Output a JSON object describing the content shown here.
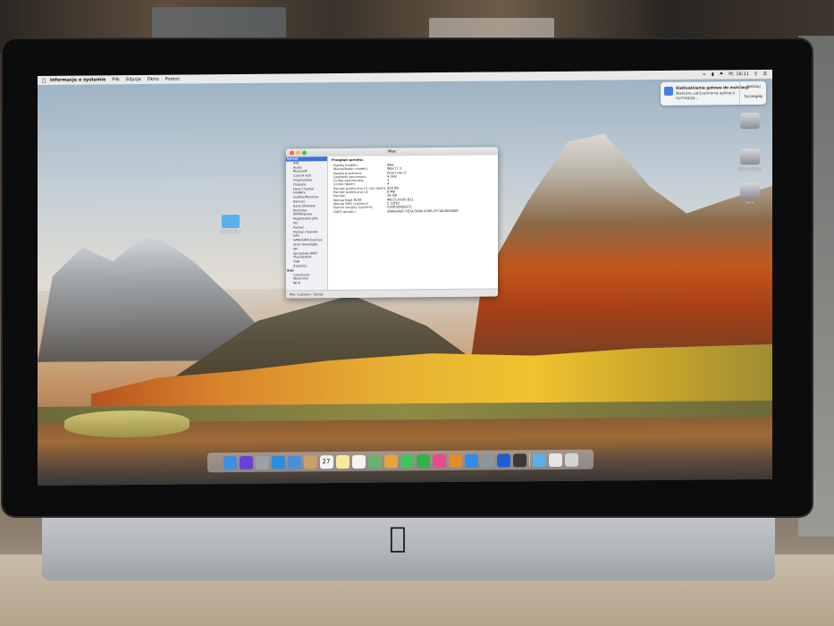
{
  "menubar": {
    "app_name": "Informacje o systemie",
    "items": [
      "Plik",
      "Edycja",
      "Okno",
      "Pomoc"
    ],
    "clock": "Pt. 16:11"
  },
  "notification": {
    "title": "Uaktualnienia gotowe do instalacji",
    "body": "Niektóre uaktualnienia aplikacji wymagają...",
    "action_primary": "Instaluj",
    "action_secondary": "Szczegóły"
  },
  "desktop": {
    "disks": [
      {
        "label": ""
      },
      {
        "label": "Dysk zapasu"
      },
      {
        "label": "HDD"
      }
    ],
    "folder_label": "Nowy folder"
  },
  "window": {
    "title": "iMac",
    "content_title": "Przegląd sprzętu:",
    "sidebar": {
      "header_hardware": "Sprzęt",
      "hardware_items": [
        "ATA",
        "Audio",
        "Bluetooth",
        "Czytnik kart",
        "Diagnostyka",
        "Drukarki",
        "Fibre Channel",
        "FireWire",
        "Grafika/Monitory",
        "Kamera",
        "Karty Ethernet",
        "Kontroler",
        "NVMExpress",
        "Nagrywanie płyt",
        "PCI",
        "Pamięć",
        "Pamięć masowa",
        "SAS",
        "SATA/SATA Express",
        "SCSI równoległe",
        "SPI",
        "Sprzętowy RAID",
        "Thunderbolt",
        "USB",
        "Zasilanie"
      ],
      "header_network": "Sieć",
      "network_items": [
        "Lokalizacje",
        "Woluminy",
        "Wi-Fi"
      ]
    },
    "specs": [
      {
        "k": "Nazwa modelu:",
        "v": "iMac"
      },
      {
        "k": "Identyfikator modelu:",
        "v": "iMac17,1"
      },
      {
        "k": "Nazwa procesora:",
        "v": "Intel Core i7"
      },
      {
        "k": "Szybkość procesora:",
        "v": "4 GHz"
      },
      {
        "k": "Liczba procesorów:",
        "v": "1"
      },
      {
        "k": "Liczba rdzeni:",
        "v": "4"
      },
      {
        "k": "Pamięć podręczna L2 (na rdzeń):",
        "v": "256 KB"
      },
      {
        "k": "Pamięć podręczna L3:",
        "v": "8 MB"
      },
      {
        "k": "Pamięć:",
        "v": "16 GB"
      },
      {
        "k": "Wersja Boot ROM:",
        "v": "IM171.0105.B21"
      },
      {
        "k": "Wersja SMC (system):",
        "v": "2.33f10"
      },
      {
        "k": "Numer seryjny (system):",
        "v": "C02R3ZRJGG7L"
      },
      {
        "k": "UUID sprzętu:",
        "v": "5DB83A85-5E5A-5684-A598-1FCAE3650808"
      }
    ],
    "status": "Mac (Lukasz) › Sprzęt"
  },
  "dock": {
    "icons": [
      {
        "name": "finder-icon",
        "color": "#3d8fe0"
      },
      {
        "name": "siri-icon",
        "color": "#6a3fd4"
      },
      {
        "name": "launchpad-icon",
        "color": "#9aa1a9"
      },
      {
        "name": "safari-icon",
        "color": "#2b8ddb"
      },
      {
        "name": "mail-icon",
        "color": "#4a90d9"
      },
      {
        "name": "contacts-icon",
        "color": "#c9a06a"
      },
      {
        "name": "calendar-icon",
        "color": "#f4f4f4"
      },
      {
        "name": "notes-icon",
        "color": "#f7e89c"
      },
      {
        "name": "reminders-icon",
        "color": "#f4f4f4"
      },
      {
        "name": "maps-icon",
        "color": "#69b36c"
      },
      {
        "name": "photos-icon",
        "color": "#e9a23b"
      },
      {
        "name": "messages-icon",
        "color": "#3ec45c"
      },
      {
        "name": "facetime-icon",
        "color": "#2fb24a"
      },
      {
        "name": "itunes-icon",
        "color": "#e74c8a"
      },
      {
        "name": "ibooks-icon",
        "color": "#e58b2a"
      },
      {
        "name": "app-store-icon",
        "color": "#2f8de6"
      },
      {
        "name": "system-preferences-icon",
        "color": "#8f959c"
      },
      {
        "name": "utility-icon",
        "color": "#1f5fd1"
      },
      {
        "name": "flag-icon",
        "color": "#3a3a3a"
      },
      {
        "name": "folder-icon",
        "color": "#5ab0ea"
      },
      {
        "name": "downloads-icon",
        "color": "#e6e6e6"
      },
      {
        "name": "trash-icon",
        "color": "#d0d3d6"
      }
    ],
    "calendar_day": "27"
  }
}
